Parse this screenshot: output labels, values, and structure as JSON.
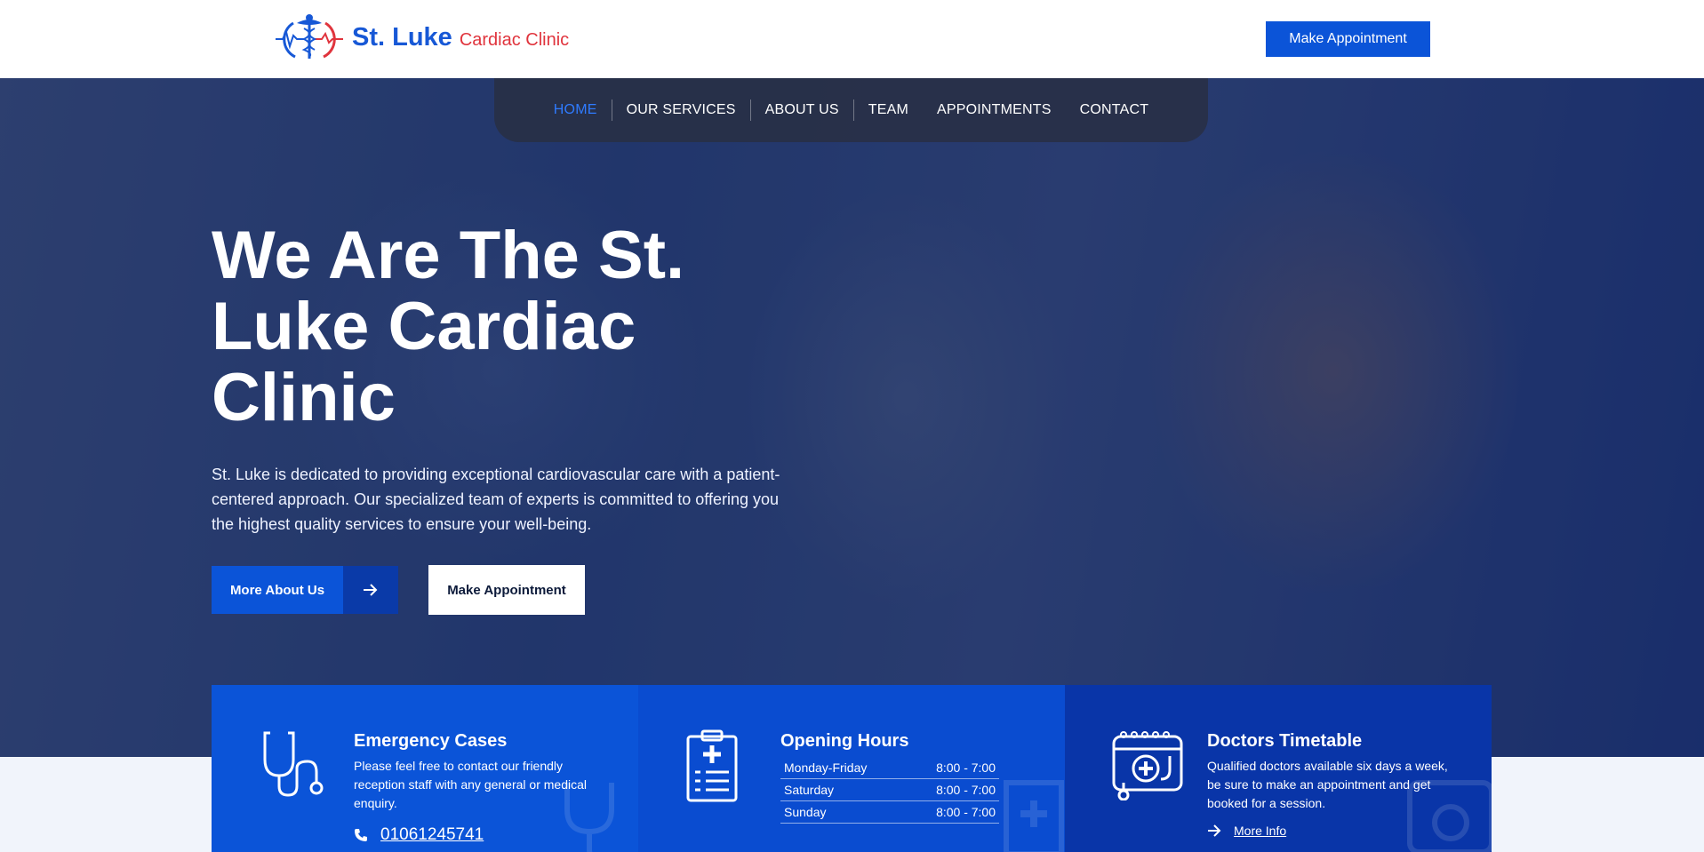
{
  "brand": {
    "name": "St. Luke",
    "sub": "Cardiac Clinic",
    "colors": {
      "primary": "#0b54d8",
      "accent": "#e0343d"
    }
  },
  "header": {
    "cta_label": "Make Appointment"
  },
  "nav": {
    "items": [
      {
        "label": "HOME",
        "active": true
      },
      {
        "label": "OUR SERVICES"
      },
      {
        "label": "ABOUT US"
      },
      {
        "label": "TEAM"
      },
      {
        "label": "APPOINTMENTS"
      },
      {
        "label": "CONTACT"
      }
    ]
  },
  "hero": {
    "title": "We Are The St. Luke Cardiac Clinic",
    "text": "St. Luke is dedicated to providing exceptional cardiovascular care with a patient-centered approach. Our specialized team of experts is committed to offering you the highest quality services to ensure your well-being.",
    "btn_more": "More About Us",
    "btn_more_icon": "arrow-right-icon",
    "btn_appt": "Make Appointment"
  },
  "cards": {
    "emergency": {
      "icon": "stethoscope-icon",
      "title": "Emergency Cases",
      "text": "Please feel free to contact our friendly reception staff with any general or medical enquiry.",
      "phone_icon": "phone-icon",
      "phone": "01061245741"
    },
    "hours": {
      "icon": "clipboard-icon",
      "title": "Opening Hours",
      "rows": [
        {
          "day": "Monday-Friday",
          "time": "8:00 - 7:00"
        },
        {
          "day": "Saturday",
          "time": "8:00 - 7:00"
        },
        {
          "day": "Sunday",
          "time": "8:00 - 7:00"
        }
      ]
    },
    "timetable": {
      "icon": "calendar-medical-icon",
      "title": "Doctors Timetable",
      "text": "Qualified doctors available six days a week, be sure to make an appointment and get booked for a session.",
      "link_icon": "arrow-right-icon",
      "link": "More Info"
    }
  }
}
